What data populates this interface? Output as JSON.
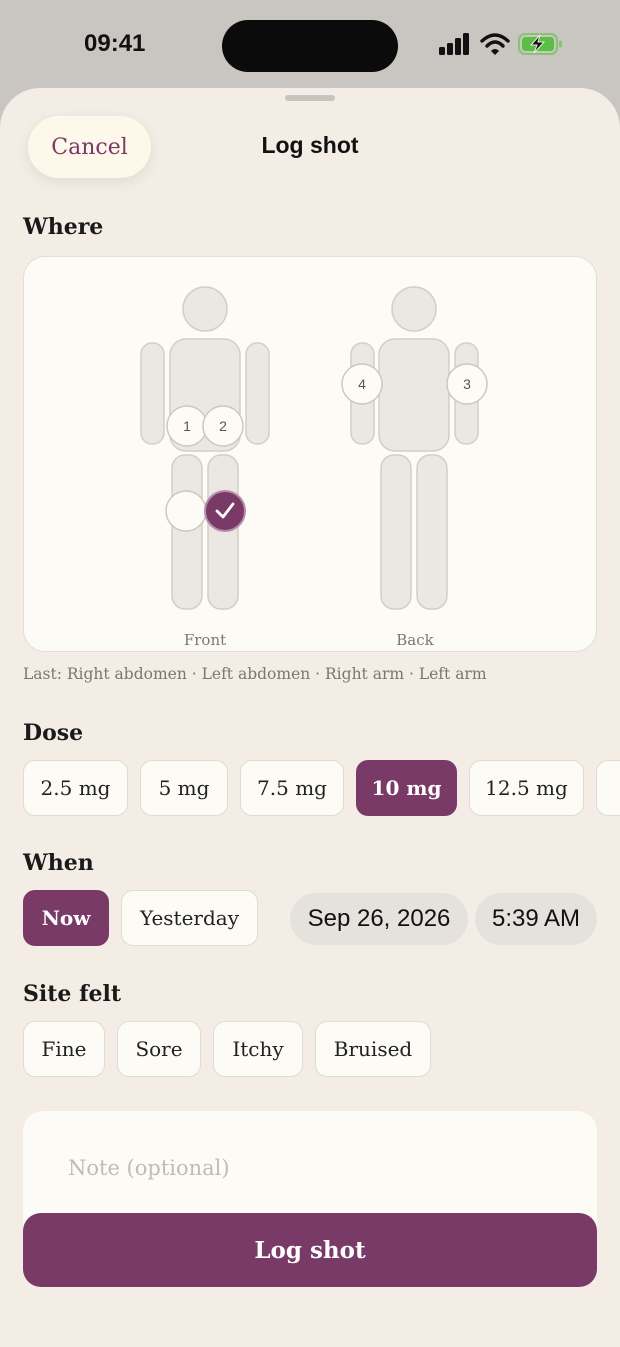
{
  "status_bar": {
    "time": "09:41"
  },
  "header": {
    "cancel_label": "Cancel",
    "title": "Log shot"
  },
  "where": {
    "label": "Where",
    "front_label": "Front",
    "back_label": "Back",
    "markers": {
      "front_1": "1",
      "front_2": "2",
      "back_3": "3",
      "back_4": "4"
    },
    "last_line": "Last:  Right abdomen · Left abdomen · Right arm · Left arm"
  },
  "dose": {
    "label": "Dose",
    "options": [
      "2.5 mg",
      "5 mg",
      "7.5 mg",
      "10 mg",
      "12.5 mg"
    ],
    "selected": "10 mg"
  },
  "when": {
    "label": "When",
    "options": [
      "Now",
      "Yesterday"
    ],
    "selected": "Now",
    "date": "Sep 26, 2026",
    "time": "5:39 AM"
  },
  "site_felt": {
    "label": "Site felt",
    "options": [
      "Fine",
      "Sore",
      "Itchy",
      "Bruised"
    ]
  },
  "note": {
    "placeholder": "Note (optional)"
  },
  "submit_label": "Log shot",
  "colors": {
    "accent": "#7a3a67",
    "sheet_bg": "#f3ede5",
    "card_bg": "#fdfbf6"
  }
}
